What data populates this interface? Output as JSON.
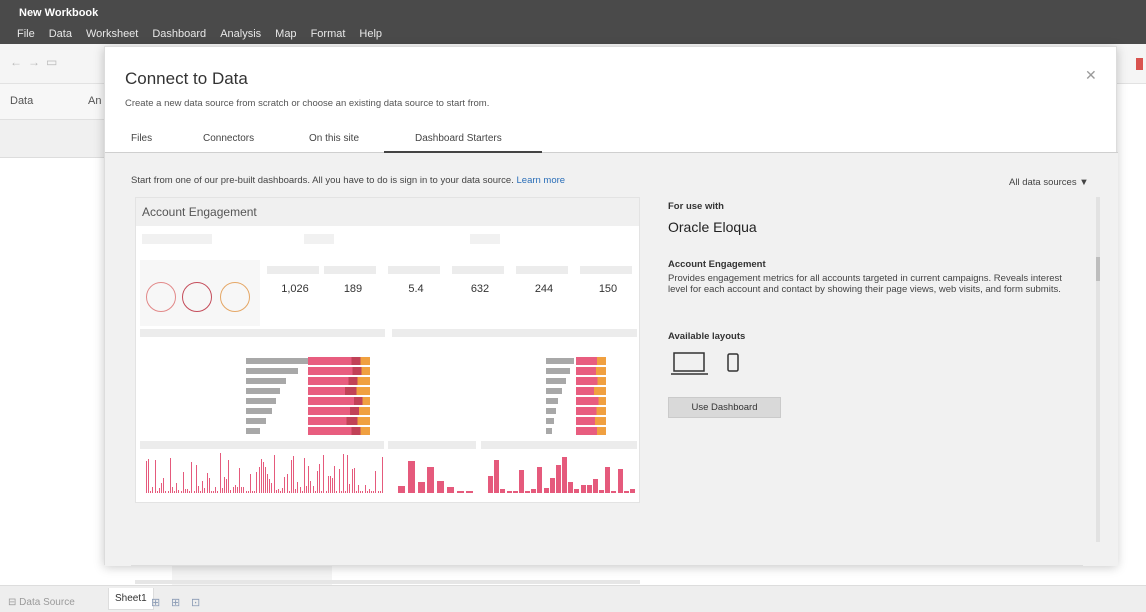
{
  "app": {
    "title": "New Workbook",
    "menu": [
      "File",
      "Data",
      "Worksheet",
      "Dashboard",
      "Analysis",
      "Map",
      "Format",
      "Help"
    ]
  },
  "side_panel": {
    "tab_data": "Data",
    "tab_analytics": "An"
  },
  "bottom": {
    "data_source": "Data Source",
    "sheet": "Sheet1"
  },
  "modal": {
    "title": "Connect to Data",
    "subtitle": "Create a new data source from scratch or choose an existing data source to start from.",
    "tabs": [
      "Files",
      "Connectors",
      "On this site",
      "Dashboard Starters"
    ],
    "active_tab": "Dashboard Starters",
    "intro_text": "Start from one of our pre-built dashboards. All you have to do is sign in to your data source.",
    "learn_more": "Learn more",
    "filter_label": "All data sources ▼"
  },
  "dashboard": {
    "thumbnail_title": "Account Engagement",
    "kpis": [
      "1,026",
      "189",
      "5.4",
      "632",
      "244",
      "150"
    ],
    "for_use_with_label": "For use with",
    "product": "Oracle Eloqua",
    "name": "Account Engagement",
    "description": "Provides engagement metrics for all accounts targeted in current campaigns. Reveals interest level for each account and contact by showing their page views, web visits, and form submits.",
    "available_layouts_label": "Available layouts",
    "layouts": [
      "laptop-icon",
      "phone-icon"
    ],
    "use_button": "Use Dashboard"
  },
  "colors": {
    "accent_pink": "#e55a7c",
    "orange": "#f0a040",
    "chrome": "#4a4a4a"
  }
}
